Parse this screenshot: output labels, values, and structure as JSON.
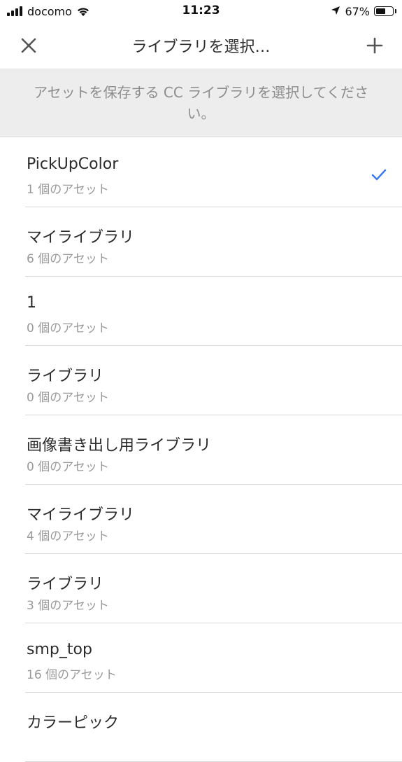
{
  "status_bar": {
    "carrier": "docomo",
    "time": "11:23",
    "battery_percent": "67%",
    "battery_level": 0.67,
    "icons": [
      "signal-icon",
      "wifi-icon",
      "location-icon",
      "battery-icon"
    ]
  },
  "nav": {
    "title": "ライブラリを選択…",
    "close_icon": "close-icon",
    "add_icon": "plus-icon"
  },
  "banner": {
    "text": "アセットを保存する CC ライブラリを選択してください。"
  },
  "libraries": [
    {
      "name": "PickUpColor",
      "count": "1 個のアセット",
      "selected": true
    },
    {
      "name": "マイライブラリ",
      "count": "6 個のアセット",
      "selected": false
    },
    {
      "name": "1",
      "count": "0 個のアセット",
      "selected": false
    },
    {
      "name": "ライブラリ",
      "count": "0 個のアセット",
      "selected": false
    },
    {
      "name": "画像書き出し用ライブラリ",
      "count": "0 個のアセット",
      "selected": false
    },
    {
      "name": "マイライブラリ",
      "count": "4 個のアセット",
      "selected": false
    },
    {
      "name": "ライブラリ",
      "count": "3 個のアセット",
      "selected": false
    },
    {
      "name": "smp_top",
      "count": "16 個のアセット",
      "selected": false
    },
    {
      "name": "カラーピック",
      "count": "",
      "selected": false
    }
  ],
  "colors": {
    "accent": "#3478f6",
    "banner_bg": "#ededed",
    "secondary_text": "#9a9a9a"
  }
}
